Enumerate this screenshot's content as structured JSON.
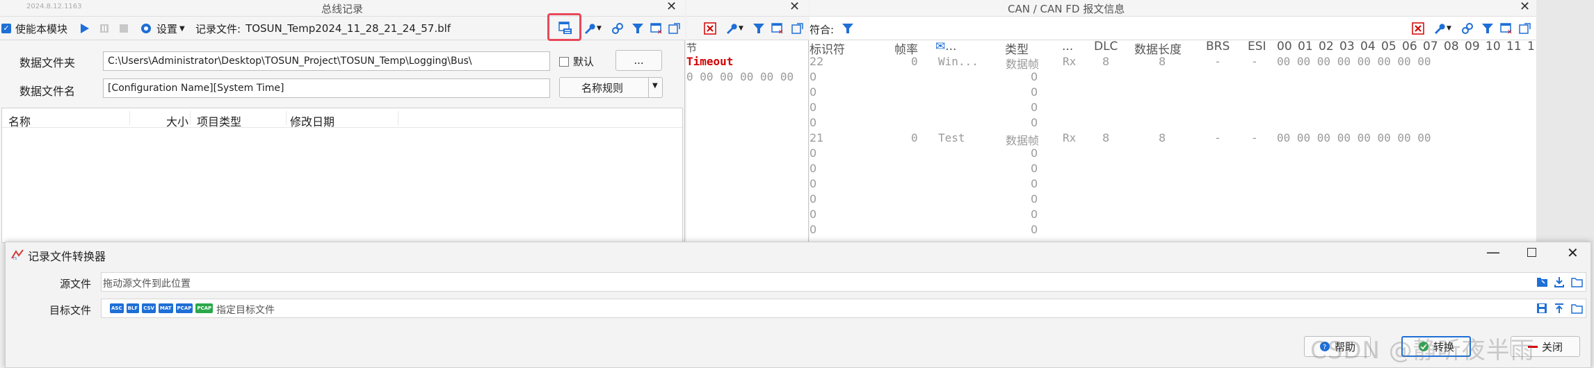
{
  "bus_panel": {
    "version": "2024.8.12.1163",
    "title": "总线记录",
    "toolbar": {
      "enable_label": "使能本模块",
      "settings_label": "设置",
      "record_file_label": "记录文件:",
      "record_file_name": "TOSUN_Temp2024_11_28_21_24_57.blf"
    },
    "folder_label": "数据文件夹",
    "folder_value": "C:\\Users\\Administrator\\Desktop\\TOSUN_Project\\TOSUN_Temp\\Logging\\Bus\\",
    "default_label": "默认",
    "browse_label": "...",
    "filename_label": "数据文件名",
    "filename_value": "[Configuration Name][System Time]",
    "naming_rule_label": "名称规则",
    "columns": {
      "name": "名称",
      "size": "大小",
      "type": "项目类型",
      "modified": "修改日期"
    }
  },
  "mid_panel": {
    "col_header": "节",
    "timeout_text": "Timeout",
    "data_bytes": "0 00 00 00 00 00"
  },
  "can_panel": {
    "title": "CAN / CAN FD 报文信息",
    "filter_label": "符合:",
    "headers": [
      "标识符",
      "帧率",
      "...",
      "类型",
      "...",
      "DLC",
      "数据长度",
      "BRS",
      "ESI",
      "00",
      "01",
      "02",
      "03",
      "04",
      "05",
      "06",
      "07",
      "08",
      "09",
      "10",
      "11",
      "1"
    ],
    "rows": [
      {
        "id": "22",
        "rate": "0",
        "name": "Win...",
        "type": "数据帧",
        "dir": "Rx",
        "dlc": "8",
        "len": "8",
        "brs": "-",
        "esi": "-",
        "data": "00 00 00 00 00 00 00 00"
      },
      {
        "id": "0",
        "type": "0"
      },
      {
        "id": "0",
        "type": "0"
      },
      {
        "id": "0",
        "type": "0"
      },
      {
        "id": "0",
        "type": "0"
      },
      {
        "id": "21",
        "rate": "0",
        "name": "Test",
        "type": "数据帧",
        "dir": "Rx",
        "dlc": "8",
        "len": "8",
        "brs": "-",
        "esi": "-",
        "data": "00 00 00 00 00 00 00 00"
      },
      {
        "id": "0",
        "type": "0"
      },
      {
        "id": "0",
        "type": "0"
      },
      {
        "id": "0",
        "type": "0"
      },
      {
        "id": "0",
        "type": "0"
      },
      {
        "id": "0",
        "type": "0"
      },
      {
        "id": "0",
        "type": "0"
      }
    ]
  },
  "dialog": {
    "title": "记录文件转换器",
    "source_label": "源文件",
    "source_placeholder": "拖动源文件到此位置",
    "target_label": "目标文件",
    "target_placeholder": "指定目标文件",
    "formats": [
      "ASC",
      "BLF",
      "CSV",
      "MAT",
      "PCAP",
      "PCAP"
    ],
    "help_label": "帮助",
    "convert_label": "转换",
    "close_label": "关闭"
  },
  "watermark": "CSDN @静听夜半雨",
  "colors": {
    "accent_blue": "#1e6fd6",
    "highlight_red": "#e8485a",
    "timeout_red": "#d40000",
    "green": "#2aa84a"
  }
}
